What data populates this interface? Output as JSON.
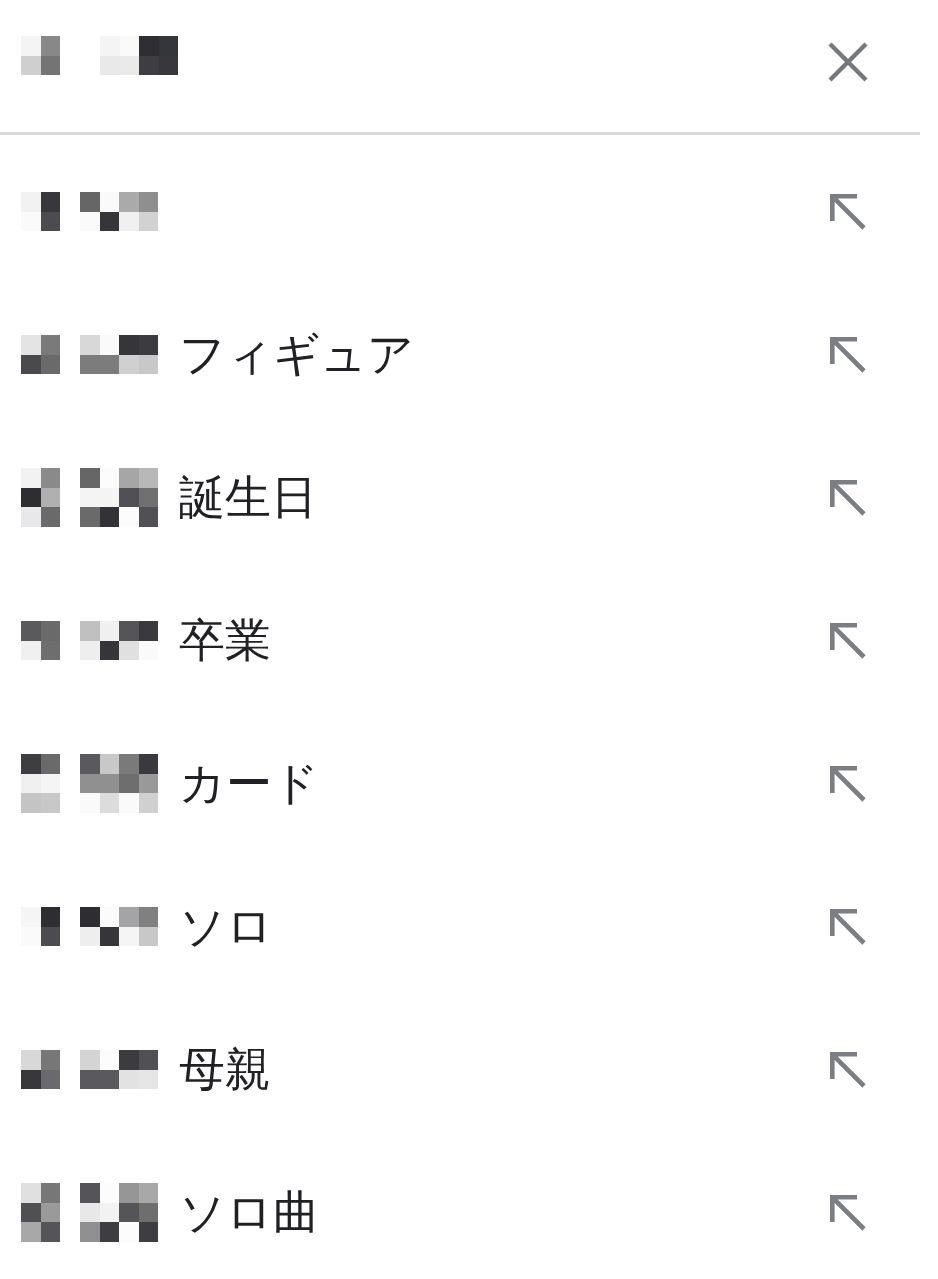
{
  "suggestions": [
    {
      "kind": "query"
    },
    {
      "kind": "completion",
      "text": "フィギュア"
    },
    {
      "kind": "completion",
      "text": "誕生日"
    },
    {
      "kind": "completion",
      "text": "卒業"
    },
    {
      "kind": "completion",
      "text": "カード"
    },
    {
      "kind": "completion",
      "text": "ソロ"
    },
    {
      "kind": "completion",
      "text": "母親"
    },
    {
      "kind": "completion",
      "text": "ソロ曲"
    }
  ]
}
